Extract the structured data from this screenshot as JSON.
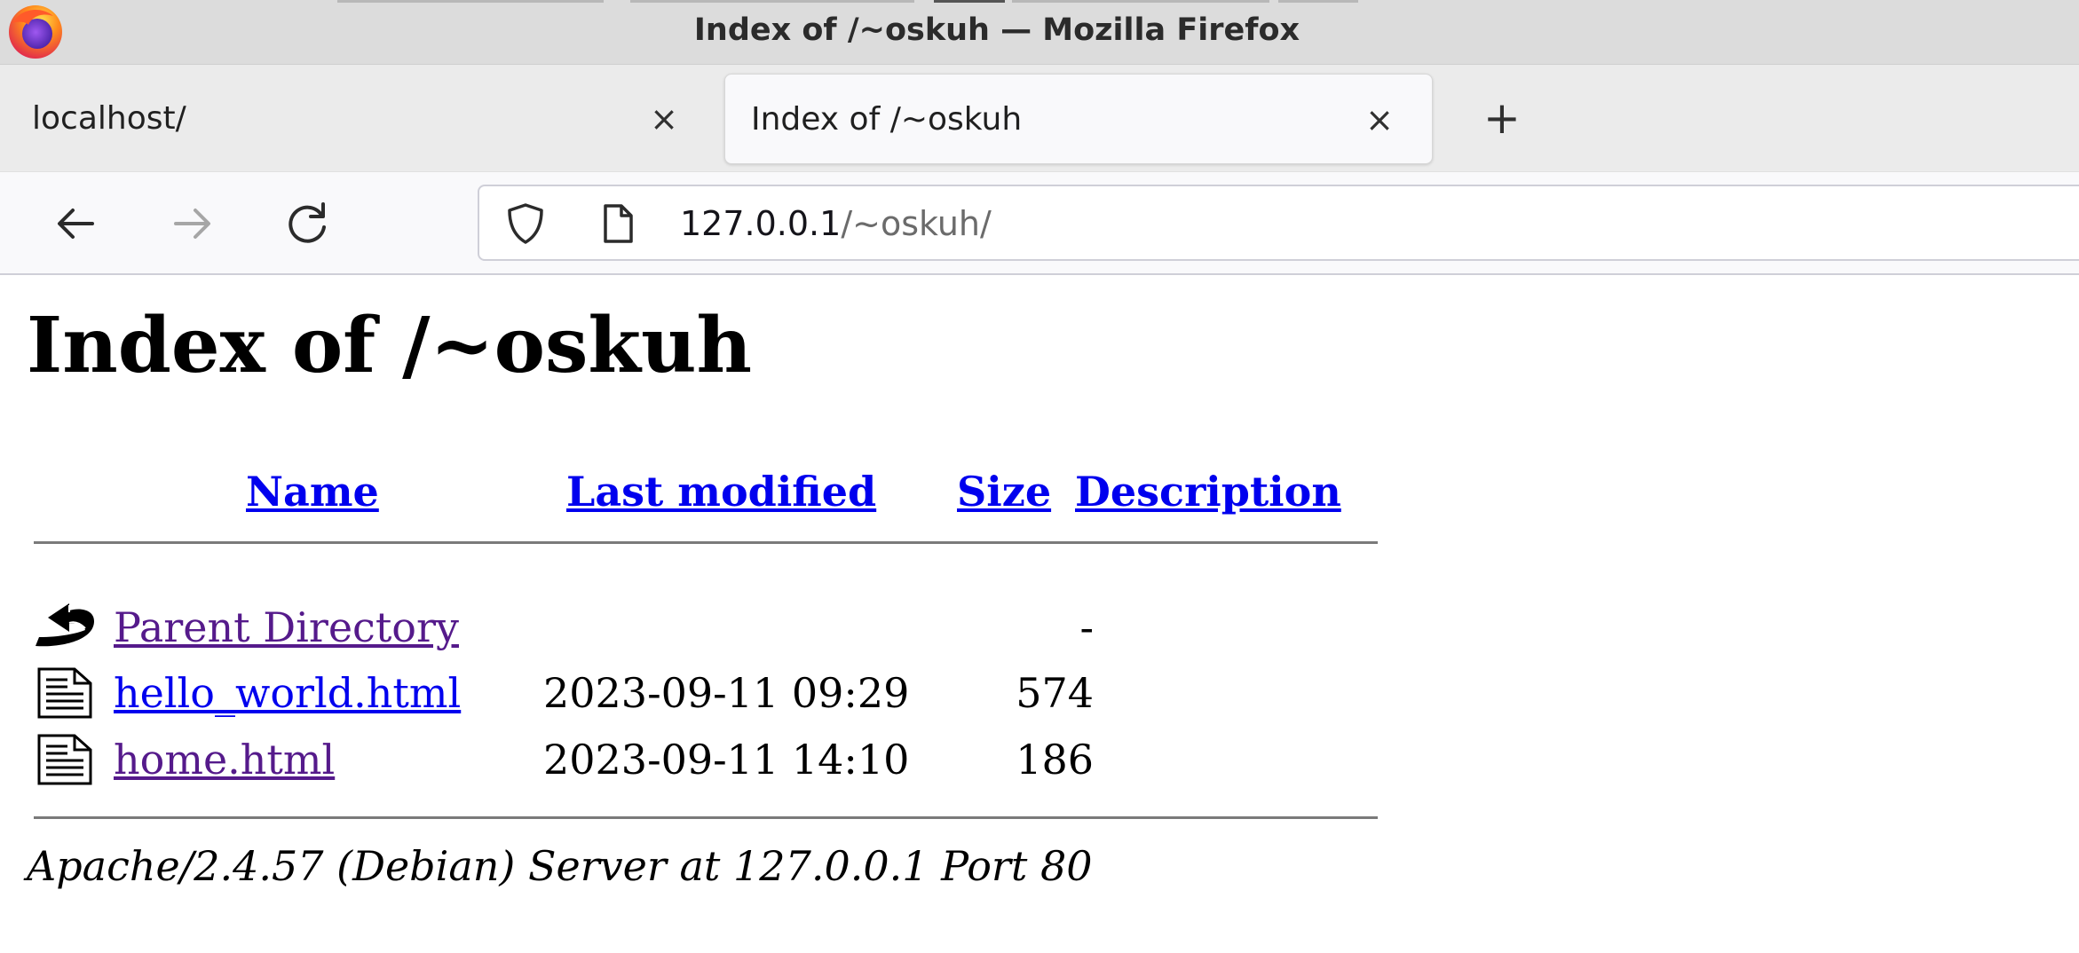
{
  "window": {
    "title": "Index of /~oskuh — Mozilla Firefox"
  },
  "tabs": [
    {
      "label": "localhost/",
      "active": false,
      "close_glyph": "×"
    },
    {
      "label": "Index of /~oskuh",
      "active": true,
      "close_glyph": "×"
    }
  ],
  "new_tab_glyph": "+",
  "navigation": {
    "back_icon": "arrow-left-icon",
    "forward_icon": "arrow-right-icon",
    "reload_icon": "reload-icon",
    "url_host": "127.0.0.1",
    "url_path": "/~oskuh/"
  },
  "page": {
    "heading": "Index of /~oskuh",
    "columns": {
      "name": "Name",
      "last_modified": "Last modified",
      "size": "Size",
      "description": "Description"
    },
    "rows": [
      {
        "icon": "back-arrow-icon",
        "name": "Parent Directory",
        "modified": "",
        "size": "-",
        "visited": true
      },
      {
        "icon": "text-file-icon",
        "name": "hello_world.html",
        "modified": "2023-09-11 09:29",
        "size": "574",
        "visited": false
      },
      {
        "icon": "text-file-icon",
        "name": "home.html",
        "modified": "2023-09-11 14:10",
        "size": "186",
        "visited": true
      }
    ],
    "address": "Apache/2.4.57 (Debian) Server at 127.0.0.1 Port 80"
  },
  "colors": {
    "link": "#0000ee",
    "visited_link": "#551a8b",
    "titlebar": "#dcdcdc",
    "tabstrip": "#ebebeb"
  }
}
